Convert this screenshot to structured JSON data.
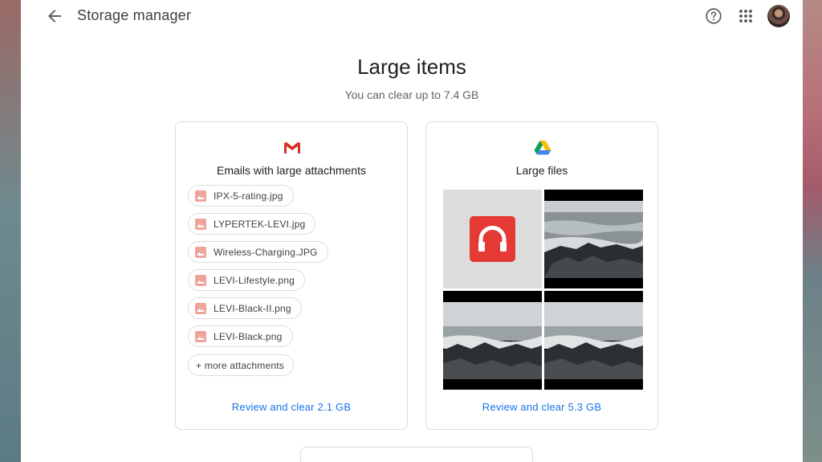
{
  "header": {
    "title": "Storage manager",
    "back_icon": "arrow-back-icon",
    "help_icon": "help-circle-icon",
    "apps_icon": "apps-grid-icon"
  },
  "main": {
    "heading": "Large items",
    "subheading": "You can clear up to 7.4 GB"
  },
  "email_card": {
    "icon": "gmail-icon",
    "title": "Emails with large attachments",
    "attachments": [
      "IPX-5-rating.jpg",
      "LYPERTEK-LEVI.jpg",
      "Wireless-Charging.JPG",
      "LEVI-Lifestyle.png",
      "LEVI-Black-II.png",
      "LEVI-Black.png"
    ],
    "more_label": "+ more attachments",
    "review_label": "Review and clear 2.1 GB"
  },
  "files_card": {
    "icon": "google-drive-icon",
    "title": "Large files",
    "thumbnails": [
      "headphone-app-icon",
      "sea-rocks-photo",
      "sea-rocks-photo",
      "sea-rocks-photo"
    ],
    "review_label": "Review and clear 5.3 GB"
  },
  "colors": {
    "link": "#1a73e8",
    "gmail_red": "#d93025",
    "image_icon": "#f0a39b",
    "headphone_tile": "#e53935"
  }
}
